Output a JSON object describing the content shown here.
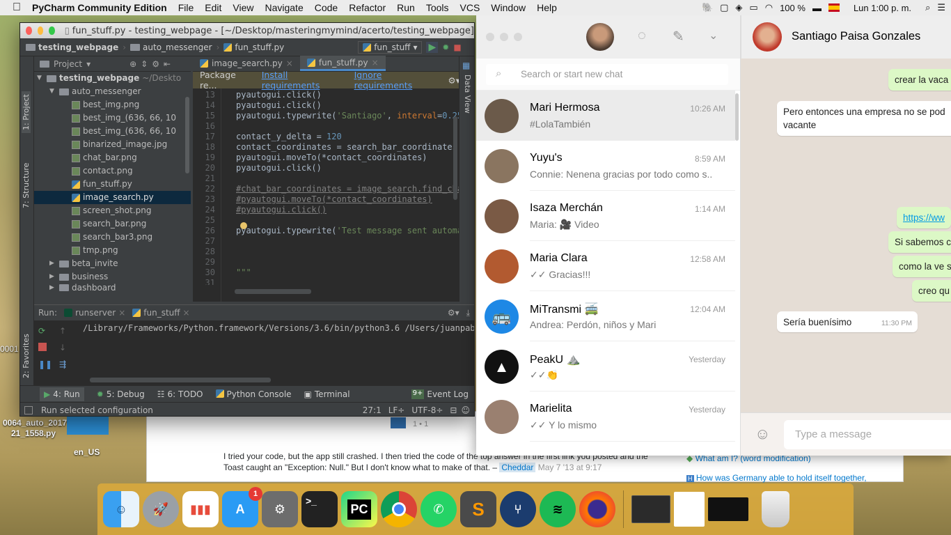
{
  "menubar": {
    "app_name": "PyCharm Community Edition",
    "menus": [
      "File",
      "Edit",
      "View",
      "Navigate",
      "Code",
      "Refactor",
      "Run",
      "Tools",
      "VCS",
      "Window",
      "Help"
    ],
    "battery": "100 %",
    "clock": "Lun 1:00 p. m."
  },
  "desktop": {
    "icon_label_1": "0001",
    "icon_label_2": "0064_auto_2017",
    "icon_label_3": "21_1558.py",
    "icon_label_4": "en_US"
  },
  "browser": {
    "votes": "1 • 1",
    "comment": "I tried your code, but the app still crashed. I then tried the code of the top answer in the first link you posted and the Toast caught an \"Exception: Null.\" But I don't know what to make of that. –",
    "comment_user": "Cheddar",
    "comment_date": "May 7 '13 at 9:17",
    "related": [
      "What am I? (word modification)",
      "How was Germany able to hold itself together,"
    ]
  },
  "pycharm": {
    "title": "fun_stuff.py - testing_webpage - [~/Desktop/masteringmymind/acerto/testing_webpage]",
    "breadcrumbs": [
      "testing_webpage",
      "auto_messenger",
      "fun_stuff.py"
    ],
    "run_config": "fun_stuff",
    "project_label": "Project",
    "tool_left_1": "1: Project",
    "tool_left_2": "7: Structure",
    "tool_left_3": "2: Favorites",
    "tool_right": "Data View",
    "tree": {
      "root": "testing_webpage",
      "root_path": "~/Deskto",
      "folder_1": "auto_messenger",
      "files": [
        "best_img.png",
        "best_img_(636, 66, 10",
        "best_img_(636, 66, 10",
        "binarized_image.jpg",
        "chat_bar.png",
        "contact.png",
        "fun_stuff.py",
        "image_search.py",
        "screen_shot.png",
        "search_bar.png",
        "search_bar3.png",
        "tmp.png"
      ],
      "folders": [
        "beta_invite",
        "business",
        "dashboard"
      ]
    },
    "tabs": [
      "image_search.py",
      "fun_stuff.py"
    ],
    "banner": {
      "text": "Package re...",
      "install": "Install requirements",
      "ignore": "Ignore requirements"
    },
    "code": {
      "lines": [
        "13",
        "14",
        "15",
        "16",
        "17",
        "18",
        "19",
        "20",
        "21",
        "22",
        "23",
        "24",
        "25",
        "26",
        "27",
        "28",
        "29",
        "30",
        "31"
      ],
      "l13": "pyautogui.click()",
      "l14": "pyautogui.click()",
      "l15a": "pyautogui.typewrite(",
      "l15b": "'Santiago'",
      "l15c": ", ",
      "l15d": "interval",
      "l15e": "=",
      "l15f": "0.25",
      "l15g": ")",
      "l17a": "contact_y_delta = ",
      "l17b": "120",
      "l18": "contact_coordinates = search_bar_coordinates(0",
      "l19": "pyautogui.moveTo(*contact_coordinates)",
      "l20": "pyautogui.click()",
      "l22": "#chat_bar_coordinates = image_search.find_cha",
      "l23": "#pyautogui.moveTo(*contact_coordinates)",
      "l24": "#pyautogui.click()",
      "l26a": "pyautogui.typewrite(",
      "l26b": "'Test message sent automat",
      "l29": "\"\"\""
    },
    "run": {
      "label": "Run:",
      "tab1": "runserver",
      "tab2": "fun_stuff",
      "output": "/Library/Frameworks/Python.framework/Versions/3.6/bin/python3.6 /Users/juanpab"
    },
    "toolwindows": [
      "4: Run",
      "5: Debug",
      "6: TODO",
      "Python Console",
      "Terminal"
    ],
    "event_log": "Event Log",
    "event_count": "9+",
    "status": "Run selected configuration",
    "status_pos": "27:1",
    "status_lf": "LF÷",
    "status_enc": "UTF-8÷"
  },
  "whatsapp": {
    "search_placeholder": "Search or start new chat",
    "chats": [
      {
        "name": "Mari Hermosa",
        "time": "10:26 AM",
        "preview": "#LolaTambién",
        "color": "#6b5a4a"
      },
      {
        "name": "Yuyu's",
        "time": "8:59 AM",
        "preview": "Connie: Nenena gracias por todo como s..",
        "color": "#8a7560"
      },
      {
        "name": "Isaza Merchán",
        "time": "1:14 AM",
        "preview": "Maria: 🎥 Video",
        "color": "#7a5a45"
      },
      {
        "name": "Maria Clara",
        "time": "12:58 AM",
        "preview": "✓✓ Gracias!!!",
        "color": "#b25a30"
      },
      {
        "name": "MiTransmi 🚎",
        "time": "12:04 AM",
        "preview": "Andrea: Perdón, niños y Mari",
        "color": "#1e88e5"
      },
      {
        "name": "PeakU ⛰️",
        "time": "Yesterday",
        "preview": "✓✓👏",
        "color": "#111111"
      },
      {
        "name": "Marielita",
        "time": "Yesterday",
        "preview": "✓✓ Y lo mismo",
        "color": "#9a8070"
      }
    ],
    "contact_name": "Santiago Paisa Gonzales",
    "messages": {
      "m1": "crear la vaca",
      "m2a": "Pero entonces una empresa no se pod",
      "m2b": "vacante",
      "m3": "https://ww",
      "m4": "Si sabemos c",
      "m5": "como la ve s",
      "m6": "creo qu",
      "m7": "Sería buenísimo",
      "m7_time": "11:30 PM"
    },
    "input_placeholder": "Type a message"
  },
  "dock": {
    "appstore_badge": "1",
    "apps": [
      "finder-icon",
      "launchpad-icon",
      "numbers-icon",
      "app-store-icon",
      "system-preferences-icon",
      "terminal-icon",
      "pycharm-icon",
      "chrome-icon",
      "whatsapp-icon",
      "sublime-text-icon",
      "sourcetree-icon",
      "spotify-icon",
      "firefox-icon"
    ]
  }
}
